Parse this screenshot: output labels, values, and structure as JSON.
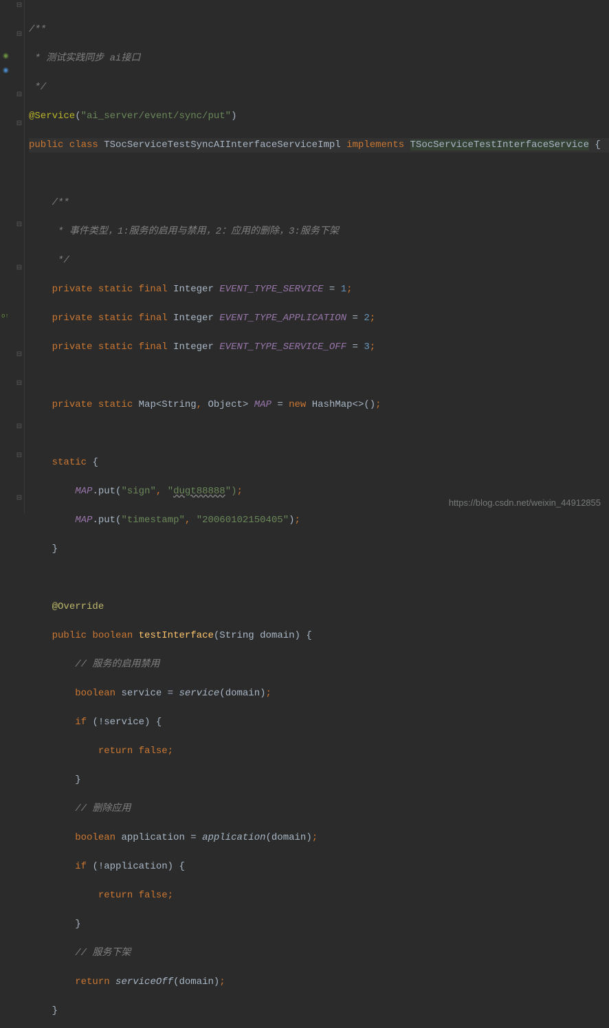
{
  "code": {
    "comment_block1": {
      "open": "/**",
      "line": " * 测试实践同步 ai接口",
      "close": " */"
    },
    "annotation": {
      "name": "@Service",
      "value": "\"ai_server/event/sync/put\""
    },
    "class_decl": {
      "modifiers": "public class",
      "name": "TSocServiceTestSyncAIInterfaceServiceImpl",
      "implements_kw": "implements",
      "interface": "TSocServiceTestInterfaceService"
    },
    "comment_block2": {
      "open": "/**",
      "line": " * 事件类型，1:服务的启用与禁用，2：应用的删除，3:服务下架",
      "close": " */"
    },
    "fields": {
      "f1": {
        "mods": "private static final",
        "type": "Integer",
        "name": "EVENT_TYPE_SERVICE",
        "eq": "=",
        "value": "1"
      },
      "f2": {
        "mods": "private static final",
        "type": "Integer",
        "name": "EVENT_TYPE_APPLICATION",
        "eq": "=",
        "value": "2"
      },
      "f3": {
        "mods": "private static final",
        "type": "Integer",
        "name": "EVENT_TYPE_SERVICE_OFF",
        "eq": "=",
        "value": "3"
      },
      "map": {
        "mods": "private static",
        "type_pre": "Map<String",
        "type_post": "Object>",
        "name": "MAP",
        "eq": "=",
        "new_kw": "new",
        "ctor": "HashMap<>()"
      }
    },
    "static_block": {
      "open": "static {",
      "put1_target": "MAP",
      "put1_method": ".put(",
      "put1_k": "\"sign\"",
      "put1_sep": ", ",
      "put1_v_open": "\"",
      "put1_v_wavy": "dugt88888",
      "put1_v_close": "\")",
      "put2_target": "MAP",
      "put2_method": ".put(",
      "put2_k": "\"timestamp\"",
      "put2_v": "\"20060102150405\"",
      "close": "}"
    },
    "method": {
      "override": "@Override",
      "sig_mods": "public",
      "sig_ret": "boolean",
      "sig_name": "testInterface",
      "sig_params_type": "String",
      "sig_params_name": "domain",
      "c_service": "// 服务的启用禁用",
      "l_service_type": "boolean",
      "l_service_name": "service",
      "l_service_eq": "=",
      "l_service_call": "service",
      "l_service_arg": "domain",
      "if1": "if",
      "if1_cond": "(!service) {",
      "ret1_kw": "return",
      "ret1_val": "false",
      "close1": "}",
      "c_app": "// 删除应用",
      "l_app_type": "boolean",
      "l_app_name": "application",
      "l_app_eq": "=",
      "l_app_call": "application",
      "l_app_arg": "domain",
      "if2": "if",
      "if2_cond": "(!application) {",
      "ret2_kw": "return",
      "ret2_val": "false",
      "close2": "}",
      "c_off": "// 服务下架",
      "ret3_kw": "return",
      "ret3_call": "serviceOff",
      "ret3_arg": "domain",
      "method_close": "}"
    }
  },
  "watermark": "https://blog.csdn.net/weixin_44912855"
}
